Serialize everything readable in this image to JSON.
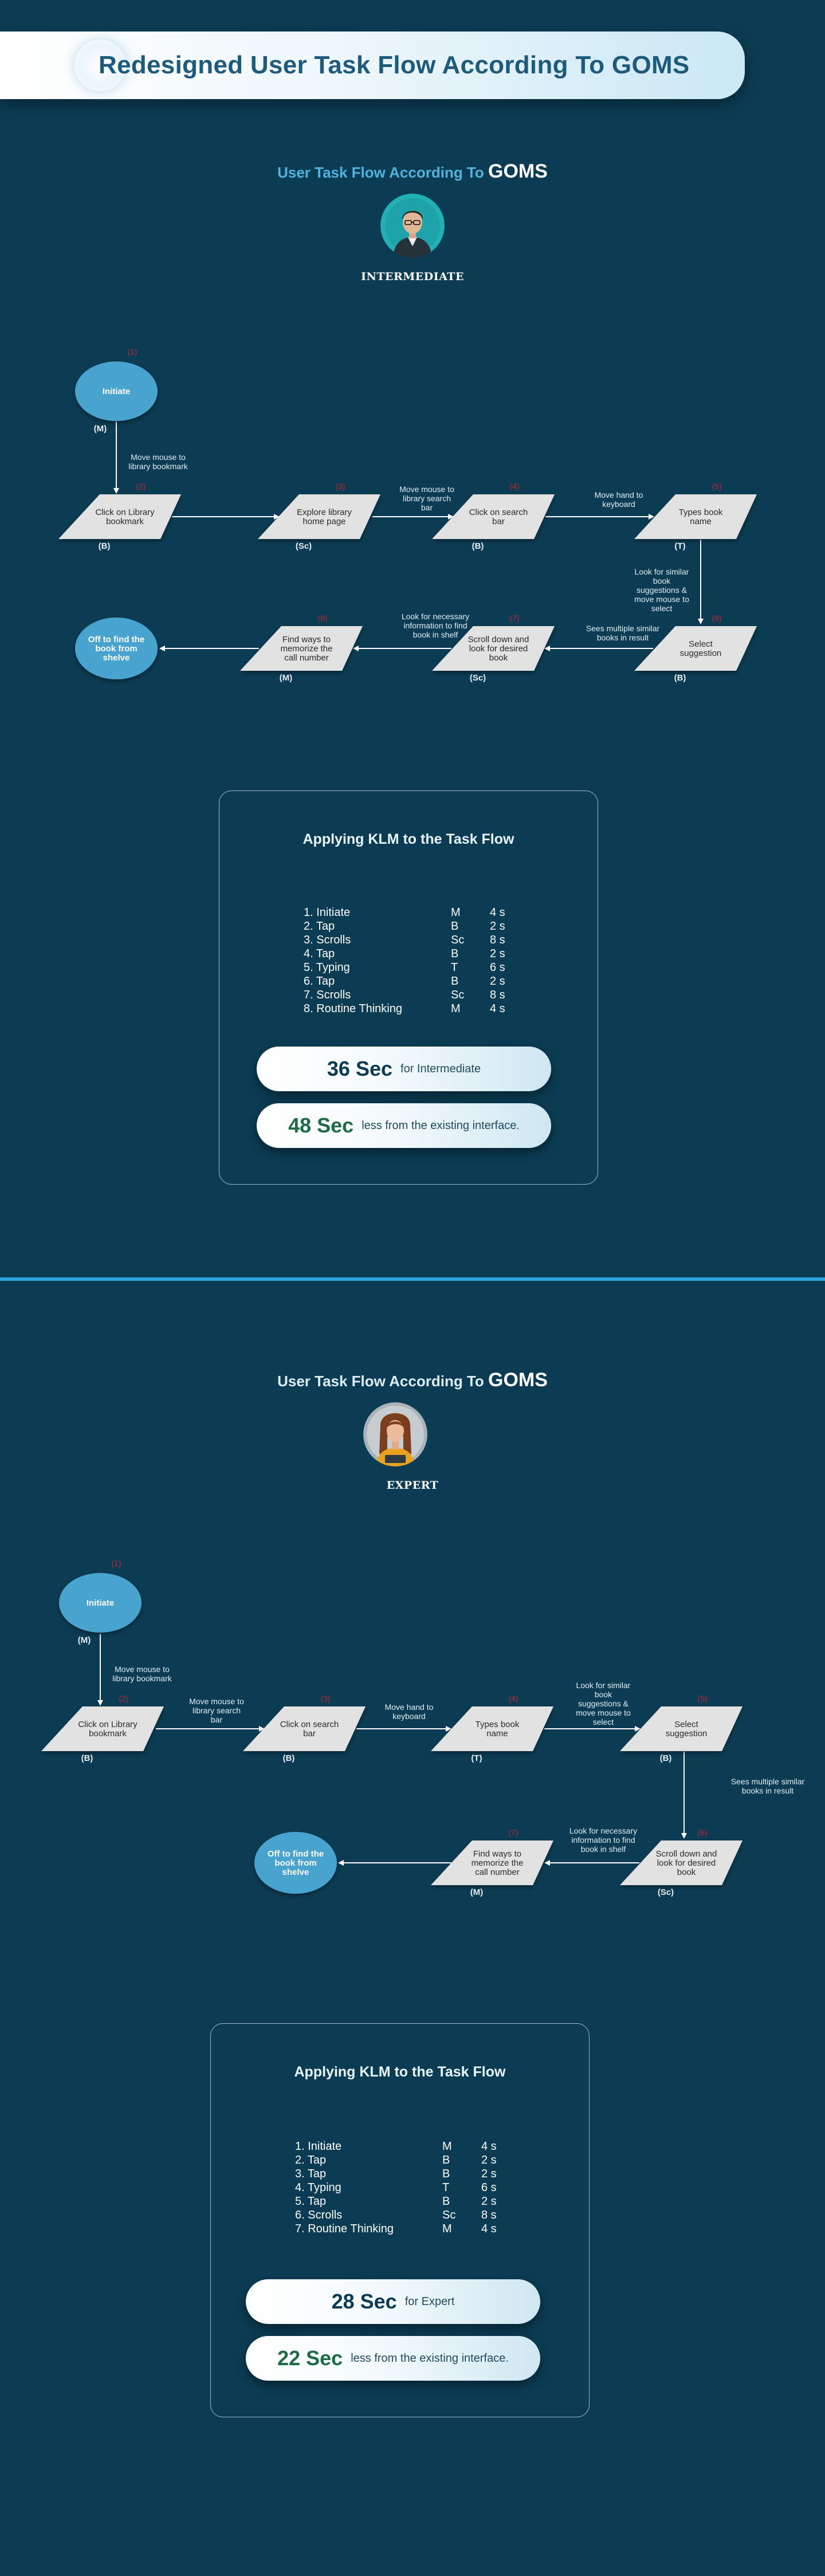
{
  "header": {
    "title": "Redesigned User Task Flow According To GOMS"
  },
  "colors": {
    "background": "#0b3c53",
    "accent": "#2aa3d8",
    "node_fill": "#e2e2e2",
    "ellipse_fill": "#4aa3cf",
    "step_number": "#c0272d",
    "highlight_green": "#1e6b46"
  },
  "sections": [
    {
      "heading_prefix": "User Task Flow According To",
      "heading_suffix": "GOMS",
      "avatar": "person-avatar",
      "level": "INTERMEDIATE",
      "flow": {
        "nodes": [
          {
            "shape": "ellipse",
            "lines": [
              "Initiate"
            ],
            "code": "(M)",
            "step": "(1)"
          },
          {
            "shape": "parallelogram",
            "lines": [
              "Click on Library",
              "bookmark"
            ],
            "code": "(B)",
            "step": "(2)"
          },
          {
            "shape": "parallelogram",
            "lines": [
              "Explore library",
              "home page"
            ],
            "code": "(Sc)",
            "step": "(3)"
          },
          {
            "shape": "parallelogram",
            "lines": [
              "Click on search",
              "bar"
            ],
            "code": "(B)",
            "step": "(4)"
          },
          {
            "shape": "parallelogram",
            "lines": [
              "Types book",
              "name"
            ],
            "code": "(T)",
            "step": "(5)"
          },
          {
            "shape": "parallelogram",
            "lines": [
              "Select",
              "suggestion"
            ],
            "code": "(B)",
            "step": "(6)"
          },
          {
            "shape": "parallelogram",
            "lines": [
              "Scroll down and",
              "look for desired",
              "book"
            ],
            "code": "(Sc)",
            "step": "(7)"
          },
          {
            "shape": "parallelogram",
            "lines": [
              "Find ways to",
              "memorize the",
              "call number"
            ],
            "code": "(M)",
            "step": "(8)"
          },
          {
            "shape": "ellipse",
            "lines": [
              "Off to find the",
              "book from",
              "shelve"
            ],
            "code": "",
            "step": ""
          }
        ],
        "edges": [
          {
            "lines": [
              "Move mouse to",
              "library bookmark"
            ]
          },
          {
            "lines": []
          },
          {
            "lines": [
              "Move mouse to",
              "library search",
              "bar"
            ]
          },
          {
            "lines": [
              "Move hand to",
              "keyboard"
            ]
          },
          {
            "lines": [
              "Look for similar",
              "book",
              "suggestions &",
              "move mouse to",
              "select"
            ]
          },
          {
            "lines": [
              "Sees multiple similar",
              "books in result"
            ]
          },
          {
            "lines": [
              "Look for necessary",
              "information to find",
              "book in shelf"
            ]
          },
          {
            "lines": []
          }
        ]
      },
      "klm": {
        "title": "Applying KLM to the Task Flow",
        "rows": [
          {
            "name": "1. Initiate",
            "code": "M",
            "time": "4 s"
          },
          {
            "name": "2. Tap",
            "code": "B",
            "time": "2 s"
          },
          {
            "name": "3. Scrolls",
            "code": "Sc",
            "time": "8 s"
          },
          {
            "name": "4. Tap",
            "code": "B",
            "time": "2 s"
          },
          {
            "name": "5. Typing",
            "code": "T",
            "time": "6 s"
          },
          {
            "name": "6. Tap",
            "code": "B",
            "time": "2 s"
          },
          {
            "name": "7. Scrolls",
            "code": "Sc",
            "time": "8 s"
          },
          {
            "name": "8. Routine Thinking",
            "code": "M",
            "time": "4 s"
          }
        ],
        "total_value": "36 Sec",
        "total_label": "for Intermediate",
        "saving_value": "48 Sec",
        "saving_label": "less from the existing interface."
      }
    },
    {
      "heading_prefix": "User Task Flow According To",
      "heading_suffix": "GOMS",
      "avatar": "person-avatar",
      "level": "EXPERT",
      "flow": {
        "nodes": [
          {
            "shape": "ellipse",
            "lines": [
              "Initiate"
            ],
            "code": "(M)",
            "step": "(1)"
          },
          {
            "shape": "parallelogram",
            "lines": [
              "Click on Library",
              "bookmark"
            ],
            "code": "(B)",
            "step": "(2)"
          },
          {
            "shape": "parallelogram",
            "lines": [
              "Click on search",
              "bar"
            ],
            "code": "(B)",
            "step": "(3)"
          },
          {
            "shape": "parallelogram",
            "lines": [
              "Types book",
              "name"
            ],
            "code": "(T)",
            "step": "(4)"
          },
          {
            "shape": "parallelogram",
            "lines": [
              "Select",
              "suggestion"
            ],
            "code": "(B)",
            "step": "(5)"
          },
          {
            "shape": "parallelogram",
            "lines": [
              "Scroll down and",
              "look for desired",
              "book"
            ],
            "code": "(Sc)",
            "step": "(6)"
          },
          {
            "shape": "parallelogram",
            "lines": [
              "Find ways to",
              "memorize the",
              "call number"
            ],
            "code": "(M)",
            "step": "(7)"
          },
          {
            "shape": "ellipse",
            "lines": [
              "Off to find the",
              "book from",
              "shelve"
            ],
            "code": "",
            "step": ""
          }
        ],
        "edges": [
          {
            "lines": [
              "Move mouse to",
              "library bookmark"
            ]
          },
          {
            "lines": [
              "Move mouse to",
              "library search",
              "bar"
            ]
          },
          {
            "lines": [
              "Move hand to",
              "keyboard"
            ]
          },
          {
            "lines": [
              "Look for similar",
              "book",
              "suggestions &",
              "move mouse to",
              "select"
            ]
          },
          {
            "lines": [
              "Sees multiple similar",
              "books in result"
            ]
          },
          {
            "lines": [
              "Look for necessary",
              "information to find",
              "book in shelf"
            ]
          },
          {
            "lines": []
          }
        ]
      },
      "klm": {
        "title": "Applying KLM to the Task Flow",
        "rows": [
          {
            "name": "1. Initiate",
            "code": "M",
            "time": "4 s"
          },
          {
            "name": "2. Tap",
            "code": "B",
            "time": "2 s"
          },
          {
            "name": "3. Tap",
            "code": "B",
            "time": "2 s"
          },
          {
            "name": "4. Typing",
            "code": "T",
            "time": "6 s"
          },
          {
            "name": "5. Tap",
            "code": "B",
            "time": "2 s"
          },
          {
            "name": "6. Scrolls",
            "code": "Sc",
            "time": "8 s"
          },
          {
            "name": "7. Routine Thinking",
            "code": "M",
            "time": "4 s"
          }
        ],
        "total_value": "28 Sec",
        "total_label": "for Expert",
        "saving_value": "22 Sec",
        "saving_label": "less from the existing interface."
      }
    }
  ]
}
